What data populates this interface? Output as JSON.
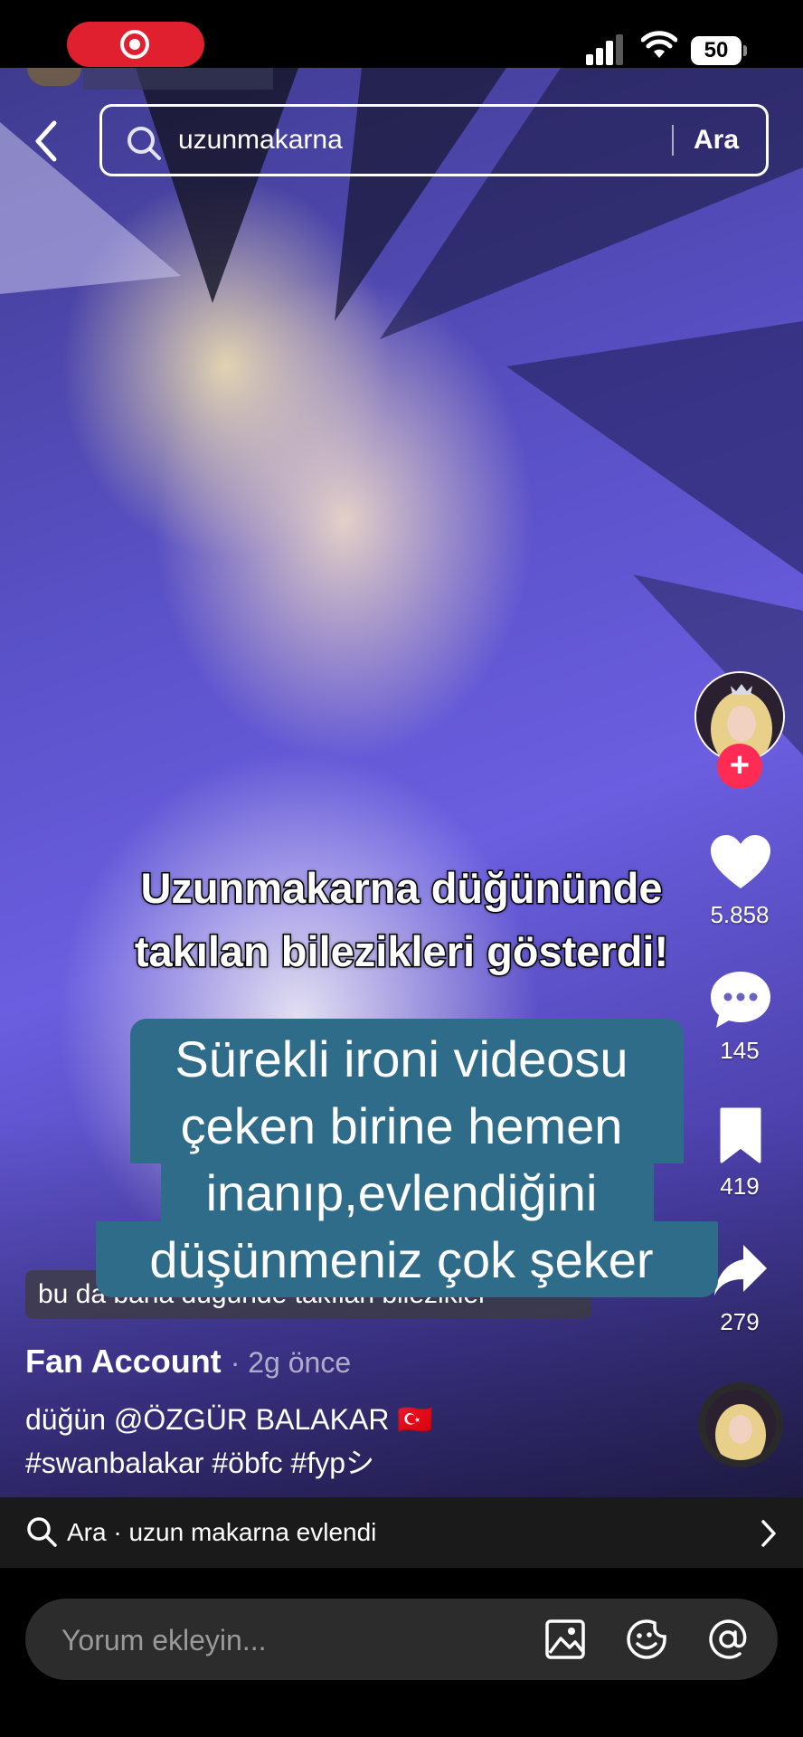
{
  "status_bar": {
    "battery": "50"
  },
  "search": {
    "query": "uzunmakarna",
    "button_label": "Ara"
  },
  "actions": {
    "likes": "5.858",
    "comments": "145",
    "saves": "419",
    "shares": "279"
  },
  "video_caption": {
    "line1": "Uzunmakarna düğününde",
    "line2": "takılan bilezikleri gösterdi!"
  },
  "comment_overlay": {
    "lines": [
      "Sürekli ironi videosu",
      "çeken birine hemen",
      "inanıp,evlendiğini",
      "düşünmeniz çok şeker"
    ]
  },
  "video_label": "bu da bana düğünde takılan bilezikler",
  "post": {
    "author": "Fan Account",
    "time_ago": "· 2g önce",
    "desc_line1": "düğün @ÖZGÜR BALAKAR 🇹🇷",
    "desc_line2": "#swanbalakar #öbfc #fypシ"
  },
  "search_suggestion": {
    "text": "Ara · uzun makarna evlendi"
  },
  "comment_input": {
    "placeholder": "Yorum ekleyin..."
  },
  "colors": {
    "follow": "#fe2c55",
    "comment_bubble": "#2f6c8a"
  },
  "icons": [
    "back-icon",
    "search-icon",
    "heart-icon",
    "comment-icon",
    "bookmark-icon",
    "share-icon",
    "image-icon",
    "emoji-icon",
    "at-icon",
    "chevron-right-icon"
  ]
}
